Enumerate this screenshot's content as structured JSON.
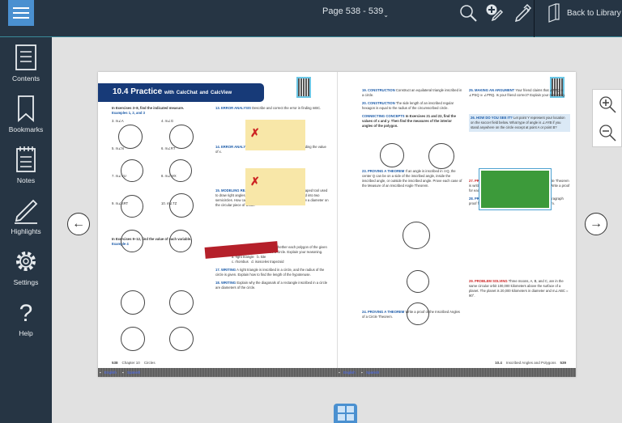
{
  "topbar": {
    "page_label": "Page 538 - 539",
    "back_label": "Back to Library"
  },
  "sidebar": [
    {
      "label": "Contents"
    },
    {
      "label": "Bookmarks"
    },
    {
      "label": "Notes"
    },
    {
      "label": "Highlights"
    },
    {
      "label": "Settings"
    },
    {
      "label": "Help"
    }
  ],
  "book": {
    "left": {
      "banner_main": "10.4 Practice",
      "banner_with": "with",
      "banner_calcchat": "CalcChat",
      "banner_and": "and",
      "banner_calcview": "CalcView",
      "intro1": "In Exercises 3–8, find the indicated measure.",
      "intro1_ex": "Examples 1, 2, and 3",
      "items": [
        "3. m∠A",
        "4. m∠G",
        "5. m∠N",
        "6. m∠RT",
        "7. m∠VU",
        "8. m∠WX",
        "9. m∠SRT",
        "10. m∠TZ"
      ],
      "intro2": "In Exercises 9–12, find the value of each variable.",
      "intro2_ex": "Example 4",
      "ex13": "13. ERROR ANALYSIS",
      "ex13_text": "Describe and correct the error in finding mBC.",
      "ex14": "14. ERROR ANALYSIS",
      "ex14_text": "Describe and correct the error in finding the value of x.",
      "ex15": "15. MODELING REAL LIFE",
      "ex15_text": "A carpenter's square is an L-shaped tool used to draw right angles. You need to cut a circular piece of wood into two semicircles. How can you use the carpenter's square to draw a diameter on the circular piece of wood?",
      "ex16": "16. REASONING",
      "ex16_text": "Determine whether each polygon of the given type can be inscribed inside a circle. Explain your reasoning.",
      "ex16_opts": [
        "a. right triangle",
        "b. kite",
        "c. rhombus",
        "d. isosceles trapezoid"
      ],
      "ex17": "17. WRITING",
      "ex17_text": "A right triangle is inscribed in a circle, and the radius of the circle is given. Explain how to find the length of the hypotenuse.",
      "ex18": "18. WRITING",
      "ex18_text": "Explain why the diagonals of a rectangle inscribed in a circle are diameters of the circle.",
      "footer_num": "538",
      "footer_chapter": "Chapter 10",
      "footer_title": "Circles"
    },
    "right": {
      "ex19": "19. CONSTRUCTION",
      "ex19_text": "Construct an equilateral triangle inscribed in a circle.",
      "ex20": "20. CONSTRUCTION",
      "ex20_text": "The side length of an inscribed regular hexagon is equal to the radius of the circumscribed circle.",
      "connect": "CONNECTING CONCEPTS",
      "connect_text": "In Exercises 21 and 22, find the values of x and y. Then find the measures of the interior angles of the polygon.",
      "ex23": "23. PROVING A THEOREM",
      "ex23_text": "If an angle is inscribed in ⊙Q, the center Q can be on a side of the inscribed angle, inside the inscribed angle, or outside the inscribed angle. Prove each case of the Measure of an Inscribed Angle Theorem.",
      "ex24": "24. PROVING A THEOREM",
      "ex24_text": "Write a proof of the Inscribed Angles of a Circle Theorem.",
      "ex25": "25. MAKING AN ARGUMENT",
      "ex25_text": "Your friend claims that ∠PTQ ≅ ∠PSQ ≅ ∠PRQ. Is your friend correct? Explain your reasoning.",
      "ex26": "26. HOW DO YOU SEE IT?",
      "ex26_text": "Let point Y represent your location on the soccer field below. What type of angle is ∠AYB if you stand anywhere on the circle except at point A or point B?",
      "ex27": "27. PROVING A THEOREM",
      "ex27_text": "The Inscribed Right Triangle Theorem is written as a conditional statement and its converse. Write a proof for each statement.",
      "ex28": "28. PROVING A THEOREM",
      "ex28_text": "Copy and complete the paragraph proof for one part of the Inscribed Quadrilateral Theorem.",
      "ex29": "29. PROBLEM SOLVING",
      "ex29_text": "Three moons, A, B, and C, are in the same circular orbit 100,000 kilometers above the surface of a planet. The planet is 20,000 kilometers in diameter and m∠ABC = 90°.",
      "footer_num": "539",
      "footer_section": "10.4",
      "footer_title": "Inscribed Angles and Polygons"
    },
    "audio": {
      "english": "English",
      "spanish": "Spanish"
    }
  }
}
